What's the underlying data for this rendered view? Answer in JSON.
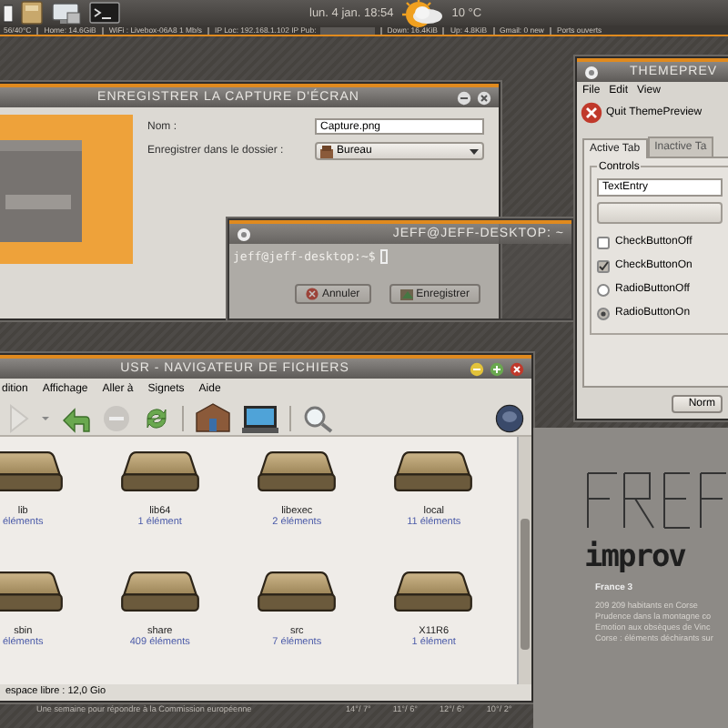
{
  "top_panel": {
    "clock": "lun. 4 jan. 18:54",
    "temperature": "10 °C"
  },
  "status_strip": [
    "56/40°C",
    "Home: 14.6GiB",
    "WiFi : Livebox-06A8 1 Mb/s",
    "IP Loc: 192.168.1.102 IP Pub:",
    "Down: 16.4KiB",
    "Up: 4.8KiB",
    "Gmail: 0 new",
    "Ports ouverts"
  ],
  "save_dialog": {
    "title": "ENREGISTRER LA CAPTURE D'ÉCRAN",
    "name_label": "Nom :",
    "name_value": "Capture.png",
    "folder_label": "Enregistrer dans le dossier :",
    "folder_value": "Bureau",
    "buttons": [
      {
        "label": "Annuler",
        "kind": "cancel"
      },
      {
        "label": "Enregistrer",
        "kind": "save"
      }
    ]
  },
  "terminal": {
    "title": "JEFF@JEFF-DESKTOP: ~",
    "prompt": "jeff@jeff-desktop:~$"
  },
  "theme_preview": {
    "title": "THEMEPREV",
    "menu": [
      "File",
      "Edit",
      "View"
    ],
    "quit_label": "Quit ThemePreview",
    "tabs": [
      {
        "label": "Active Tab",
        "selected": true
      },
      {
        "label": "Inactive Ta",
        "selected": false
      }
    ],
    "group_label": "Controls",
    "text_entry": "TextEntry",
    "options": [
      {
        "kind": "check",
        "label": "CheckButtonOff",
        "checked": false
      },
      {
        "kind": "check",
        "label": "CheckButtonOn",
        "checked": true
      },
      {
        "kind": "radio",
        "label": "RadioButtonOff",
        "selected": false
      },
      {
        "kind": "radio",
        "label": "RadioButtonOn",
        "selected": true
      }
    ],
    "bottom_button": "Norm"
  },
  "file_manager": {
    "title": "USR - NAVIGATEUR DE FICHIERS",
    "menu": [
      "dition",
      "Affichage",
      "Aller à",
      "Signets",
      "Aide"
    ],
    "folders": [
      {
        "name": "lib",
        "count": "éléments"
      },
      {
        "name": "lib64",
        "count": "1 élément"
      },
      {
        "name": "libexec",
        "count": "2 éléments"
      },
      {
        "name": "local",
        "count": "11 éléments"
      },
      {
        "name": "sbin",
        "count": "éléments"
      },
      {
        "name": "share",
        "count": "409 éléments"
      },
      {
        "name": "src",
        "count": "7 éléments"
      },
      {
        "name": "X11R6",
        "count": "1 élément"
      }
    ],
    "free_space": "espace libre : 12,0 Gio"
  },
  "desktop": {
    "logo_text": "improv",
    "channel": "France 3",
    "news": [
      "209 209 habitants en Corse",
      "Prudence dans la montagne co",
      "Emotion aux obsèques de Vinc",
      "Corse : éléments déchirants sur"
    ],
    "headline": "Une semaine pour répondre à la Commission européenne",
    "forecast": [
      "14°/ 7°",
      "11°/ 6°",
      "12°/ 6°",
      "10°/ 2°"
    ]
  }
}
